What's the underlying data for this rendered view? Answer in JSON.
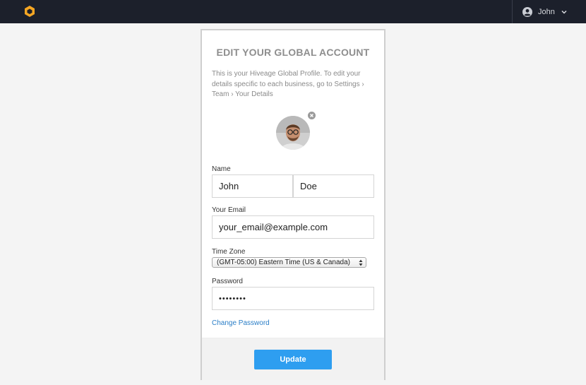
{
  "topbar": {
    "logo": "hexagon-logo-icon",
    "user_name": "John",
    "user_icon": "user-circle-icon",
    "menu_icon": "chevron-down-icon"
  },
  "card": {
    "title": "EDIT YOUR GLOBAL ACCOUNT",
    "description": "This is your Hiveage Global Profile. To edit your details specific to each business, go to Settings › Team › Your Details",
    "photo_icon": "profile-photo",
    "remove_icon": "close-icon"
  },
  "form": {
    "name_label": "Name",
    "first_name": "John",
    "last_name": "Doe",
    "email_label": "Your Email",
    "email": "your_email@example.com",
    "timezone_label": "Time Zone",
    "timezone": "(GMT-05:00) Eastern Time (US & Canada)",
    "password_label": "Password",
    "password_mask": "••••••••",
    "change_password": "Change Password",
    "update_button": "Update"
  },
  "colors": {
    "topbar": "#1c202b",
    "accent": "#2e9ef0",
    "link": "#2a7ec7",
    "logo": "#f5a623"
  }
}
